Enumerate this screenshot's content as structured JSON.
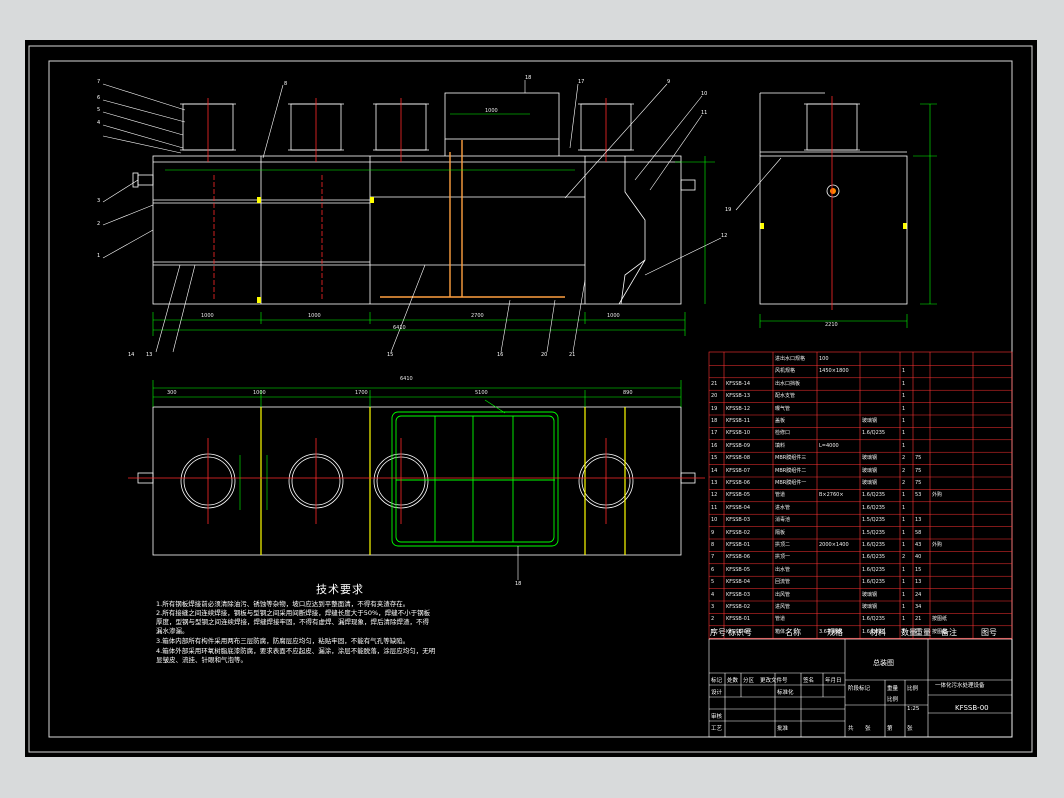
{
  "callouts": {
    "front": [
      "7",
      "6",
      "5",
      "4",
      "3",
      "2",
      "1",
      "8",
      "18",
      "17",
      "9",
      "10",
      "11",
      "12",
      "19",
      "14",
      "13",
      "15",
      "16",
      "20",
      "21"
    ],
    "plan_18": "18"
  },
  "dimensions": {
    "top_width_label": "1000",
    "front_bottom": [
      "1000",
      "1000",
      "2700",
      "1000"
    ],
    "front_total": "6410",
    "plan_top": [
      "300",
      "1000",
      "1700",
      "5100",
      "890"
    ],
    "plan_total": "6410",
    "side_bottom": "2210"
  },
  "notes": {
    "title": "技术要求",
    "lines": [
      "1.所有钢板焊接前必须清除油污、锈蚀等杂物，坡口应达到平整面清，不得有夹渣存在。",
      "2.所有接缝之间连续焊接，钢板与型钢之间采用间断焊接，焊缝长度大于50%，焊缝不小于钢板",
      "厚度，型钢与型钢之间连续焊接，焊缝焊接牢固，不得有虚焊、漏焊现象，焊后清除焊渣，不得",
      "漏水渗漏。",
      "3.箱体内部所有构件采用两布三层防腐，防腐层应均匀，粘贴牢固，不能有气孔等缺陷。",
      "4.箱体外部采用环氧树脂底漆防腐，要求表面不应起皮、漏涂，涂层不能脱落，涂层应均匀，无明",
      "显皱皮、流挂、针眼和气泡等。"
    ]
  },
  "bom": {
    "header": [
      "序号",
      "标识号",
      "名称",
      "规格",
      "材料",
      "数量",
      "重量",
      "备注",
      "图号"
    ],
    "top_rows": [
      [
        "",
        "",
        "进出水口规格",
        "100",
        "",
        "",
        "",
        ""
      ],
      [
        "",
        "",
        "风机规格",
        "1450×1800",
        "",
        "1",
        "",
        ""
      ]
    ],
    "rows": [
      [
        "21",
        "KFSSB-14",
        "出水口挡板",
        "",
        "",
        "1",
        "",
        ""
      ],
      [
        "20",
        "KFSSB-13",
        "配水支管",
        "",
        "",
        "1",
        "",
        ""
      ],
      [
        "19",
        "KFSSB-12",
        "曝气管",
        "",
        "",
        "1",
        "",
        ""
      ],
      [
        "18",
        "KFSSB-11",
        "盖板",
        "",
        "玻璃钢",
        "1",
        "",
        ""
      ],
      [
        "17",
        "KFSSB-10",
        "检修口",
        "",
        "1.6/Q235",
        "1",
        "",
        ""
      ],
      [
        "16",
        "KFSSB-09",
        "填料",
        "L=4000",
        "",
        "1",
        "",
        ""
      ],
      [
        "15",
        "KFSSB-08",
        "MBR膜组件三",
        "",
        "玻璃钢",
        "2",
        "75",
        ""
      ],
      [
        "14",
        "KFSSB-07",
        "MBR膜组件二",
        "",
        "玻璃钢",
        "2",
        "75",
        ""
      ],
      [
        "13",
        "KFSSB-06",
        "MBR膜组件一",
        "",
        "玻璃钢",
        "2",
        "75",
        ""
      ],
      [
        "12",
        "KFSSB-05",
        "管道",
        "B×2760×",
        "1.6/Q235",
        "1",
        "53",
        "外购"
      ],
      [
        "11",
        "KFSSB-04",
        "进水管",
        "",
        "1.6/Q235",
        "1",
        "",
        ""
      ],
      [
        "10",
        "KFSSB-03",
        "消毒池",
        "",
        "1.5/Q235",
        "1",
        "13",
        ""
      ],
      [
        "9",
        "KFSSB-02",
        "隔板",
        "",
        "1.5/Q235",
        "1",
        "58",
        ""
      ],
      [
        "8",
        "KFSSB-01",
        "拱顶二",
        "2000×1400",
        "1.6/Q235",
        "1",
        "43",
        "外购"
      ],
      [
        "7",
        "KFSSB-06",
        "拱顶一",
        "",
        "1.6/Q235",
        "2",
        "40",
        ""
      ],
      [
        "6",
        "KFSSB-05",
        "出水管",
        "",
        "1.6/Q235",
        "1",
        "15",
        ""
      ],
      [
        "5",
        "KFSSB-04",
        "回流管",
        "",
        "1.6/Q235",
        "1",
        "13",
        ""
      ],
      [
        "4",
        "KFSSB-03",
        "出风管",
        "",
        "玻璃钢",
        "1",
        "24",
        ""
      ],
      [
        "3",
        "KFSSB-02",
        "进风管",
        "",
        "玻璃钢",
        "1",
        "34",
        ""
      ],
      [
        "2",
        "KFSSB-01",
        "管道",
        "",
        "1.6/Q235",
        "1",
        "21",
        "按图纸"
      ],
      [
        "1",
        "KFSSB-00",
        "箱体",
        "3.6不锈钢",
        "1.6/Q235",
        "1",
        "",
        "按图纸"
      ]
    ]
  },
  "title_block": {
    "drawing_name": "总装图",
    "project": "一体化污水处理设备",
    "drawing_no": "KFSSB-00",
    "scale_label": "比例",
    "scale": "1:25",
    "labels": [
      "标记",
      "处数",
      "分区",
      "更改文件号",
      "签名",
      "年月日",
      "设计",
      "标准化",
      "审核",
      "工艺",
      "批准",
      "阶段标记",
      "重量",
      "比例",
      "共",
      "张",
      "第",
      "张"
    ]
  },
  "colors": {
    "background": "#000000",
    "frame": "#d8d8d8",
    "outline": "#ffffff",
    "centerline": "#ff2a2a",
    "dimension": "#00ff00",
    "marker": "#ffff00",
    "table_border": "#ff3333"
  }
}
